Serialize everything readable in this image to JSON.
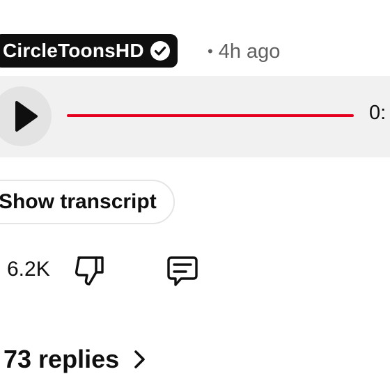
{
  "comment": {
    "author": "CircleToonsHD",
    "verified": true,
    "separator": "•",
    "time_ago": "4h ago"
  },
  "audio_player": {
    "time_display": "0:",
    "accent_color": "#e6001f",
    "play_icon": "play-icon"
  },
  "transcript_button": {
    "label": "Show transcript"
  },
  "actions": {
    "like_count": "6.2K",
    "dislike_icon": "thumbs-down-icon",
    "comment_icon": "comment-icon"
  },
  "replies": {
    "label": "73 replies",
    "icon": "chevron-right-icon"
  }
}
